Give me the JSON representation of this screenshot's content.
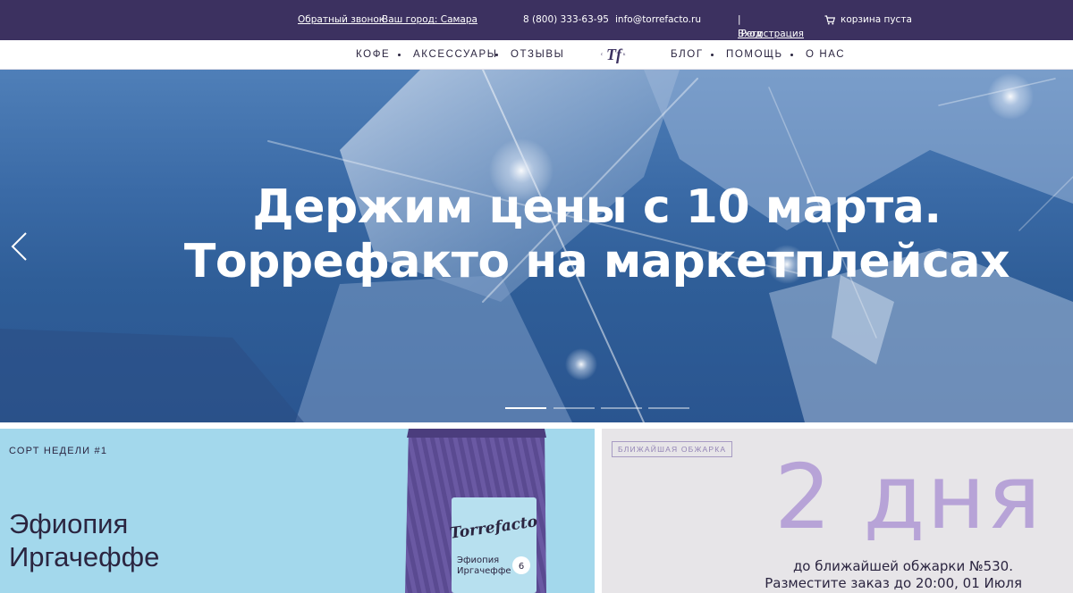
{
  "topbar": {
    "callback": "Обратный звонок",
    "city": "Ваш город: Самара",
    "phone": "8 (800) 333-63-95",
    "email": "info@torrefacto.ru",
    "login": "Вход",
    "separator": "|",
    "register": "Регистрация",
    "cart": "корзина пуста",
    "cart_icon": "cart-icon"
  },
  "nav": {
    "coffee": "КОФЕ",
    "accessories": "АКСЕССУАРЫ",
    "reviews": "ОТЗЫВЫ",
    "blog": "БЛОГ",
    "help": "ПОМОЩЬ",
    "about": "О НАС",
    "logo_icon": "torrefacto-monogram-logo"
  },
  "hero": {
    "line1": "Держим цены с 10 марта.",
    "line2": "Торрефакто на маркетплейсах",
    "prev_icon": "chevron-left-icon",
    "slides_total": 4,
    "active_slide": 1
  },
  "promo_left": {
    "label": "СОРТ НЕДЕЛИ #1",
    "title_line1": "Эфиопия",
    "title_line2": "Иргачеффе",
    "pack": {
      "brand": "Torrefacto",
      "name_line1": "Эфиопия",
      "name_line2": "Иргачеффе",
      "number": "6"
    }
  },
  "promo_right": {
    "badge": "БЛИЖАЙШАЯ ОБЖАРКА",
    "days": "2 дня",
    "line1": "до ближайшей обжарки №530.",
    "line2": "Разместите заказ до 20:00, 01 Июля"
  },
  "colors": {
    "topbar_bg": "#3c3160",
    "accent_purple": "#b7a3d7",
    "card_blue": "#a3d8ec",
    "card_gray": "#e7e5e8"
  }
}
